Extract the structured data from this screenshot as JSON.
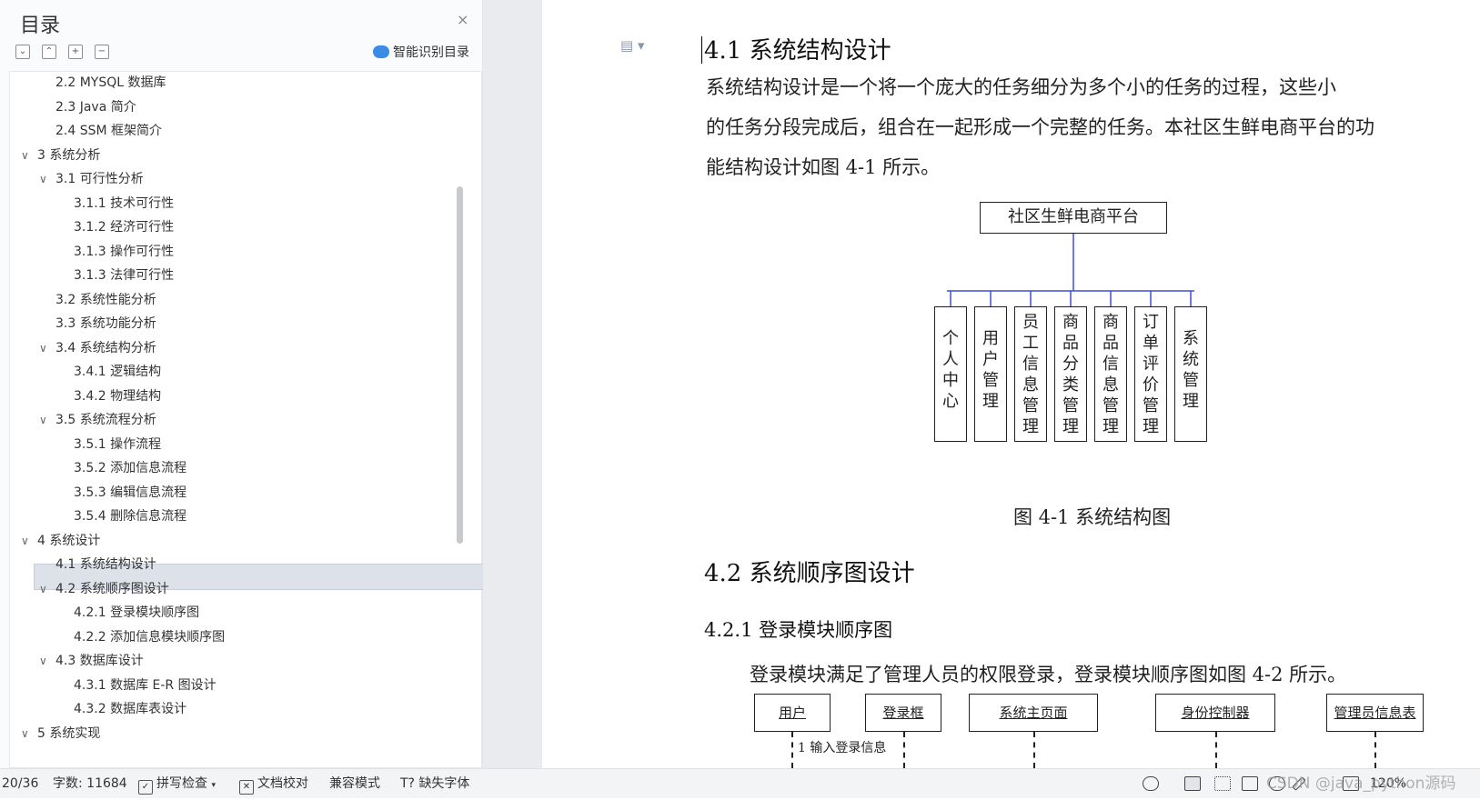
{
  "toc": {
    "title": "目录",
    "close_icon": "×",
    "toolbar": [
      "⌄",
      "⌃",
      "+",
      "−"
    ],
    "smart_label": "智能识别目录",
    "items": [
      {
        "label": "2.2 MYSQL 数据库",
        "level": 1,
        "chevron": false
      },
      {
        "label": "2.3 Java 简介",
        "level": 1,
        "chevron": false
      },
      {
        "label": "2.4 SSM 框架简介",
        "level": 1,
        "chevron": false
      },
      {
        "label": "3  系统分析",
        "level": 0,
        "chevron": true
      },
      {
        "label": "3.1  可行性分析",
        "level": 1,
        "chevron": true
      },
      {
        "label": "3.1.1  技术可行性",
        "level": 2,
        "chevron": false
      },
      {
        "label": "3.1.2  经济可行性",
        "level": 2,
        "chevron": false
      },
      {
        "label": "3.1.3  操作可行性",
        "level": 2,
        "chevron": false
      },
      {
        "label": "3.1.3  法律可行性",
        "level": 2,
        "chevron": false
      },
      {
        "label": "3.2  系统性能分析",
        "level": 1,
        "chevron": false
      },
      {
        "label": "3.3  系统功能分析",
        "level": 1,
        "chevron": false
      },
      {
        "label": "3.4  系统结构分析",
        "level": 1,
        "chevron": true
      },
      {
        "label": "3.4.1 逻辑结构",
        "level": 2,
        "chevron": false
      },
      {
        "label": "3.4.2  物理结构",
        "level": 2,
        "chevron": false
      },
      {
        "label": "3.5  系统流程分析",
        "level": 1,
        "chevron": true
      },
      {
        "label": "3.5.1  操作流程",
        "level": 2,
        "chevron": false
      },
      {
        "label": "3.5.2  添加信息流程",
        "level": 2,
        "chevron": false
      },
      {
        "label": "3.5.3  编辑信息流程",
        "level": 2,
        "chevron": false
      },
      {
        "label": "3.5.4  删除信息流程",
        "level": 2,
        "chevron": false
      },
      {
        "label": "4  系统设计",
        "level": 0,
        "chevron": true
      },
      {
        "label": "4.1  系统结构设计",
        "level": 1,
        "chevron": false,
        "selected": true
      },
      {
        "label": "4.2  系统顺序图设计",
        "level": 1,
        "chevron": true
      },
      {
        "label": "4.2.1 登录模块顺序图",
        "level": 2,
        "chevron": false
      },
      {
        "label": "4.2.2 添加信息模块顺序图",
        "level": 2,
        "chevron": false
      },
      {
        "label": "4.3  数据库设计",
        "level": 1,
        "chevron": true
      },
      {
        "label": "4.3.1 数据库 E-R 图设计",
        "level": 2,
        "chevron": false
      },
      {
        "label": "4.3.2 数据库表设计",
        "level": 2,
        "chevron": false
      },
      {
        "label": "5  系统实现",
        "level": 0,
        "chevron": true
      }
    ]
  },
  "document": {
    "heading_4_1": "4.1  系统结构设计",
    "para_lines": [
      "        系统结构设计是一个将一个庞大的任务细分为多个小的任务的过程，这些小",
      "的任务分段完成后，组合在一起形成一个完整的任务。本社区生鲜电商平台的功",
      "能结构设计如图 4-1 所示。"
    ],
    "diagram_root": "社区生鲜电商平台",
    "diagram_leaves": [
      "个人中心",
      "用户管理",
      "员工信息管理",
      "商品分类管理",
      "商品信息管理",
      "订单评价管理",
      "系统管理"
    ],
    "figure_caption": "图 4-1 系统结构图",
    "heading_4_2": "4.2  系统顺序图设计",
    "heading_4_2_1": "4.2.1 登录模块顺序图",
    "para_4_2_1": "登录模块满足了管理人员的权限登录，登录模块顺序图如图 4-2 所示。",
    "seq_boxes": [
      "用户",
      "登录框",
      "系统主页面",
      "身份控制器",
      "管理员信息表"
    ],
    "seq_message": "1  输入登录信息"
  },
  "status_bar": {
    "page": "20/36",
    "word_count": "字数: 11684",
    "spell_check": "拼写检查",
    "doc_proof": "文档校对",
    "compat_mode": "兼容模式",
    "missing_font": "缺失字体",
    "zoom": "120%",
    "watermark": "CSDN @java_python源码"
  },
  "colors": {
    "connector": "#3b4fd6",
    "selection": "#dde2ea",
    "accent": "#3c8ce7"
  }
}
